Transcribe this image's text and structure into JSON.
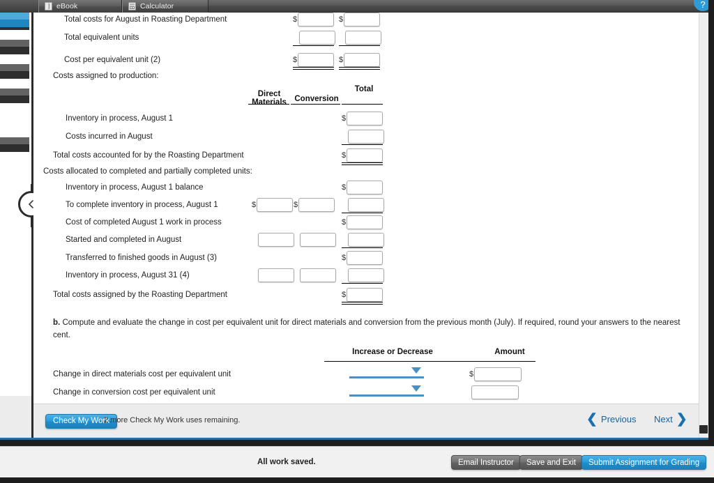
{
  "window": {
    "tabs": [
      {
        "label": "eBook",
        "icon": "book-icon"
      },
      {
        "label": "Calculator",
        "icon": "calculator-icon"
      }
    ]
  },
  "worksheet": {
    "top_rows": [
      {
        "label": "Total costs for August in Roasting Department",
        "dollar": true,
        "underline": "none"
      },
      {
        "label": "Total equivalent units",
        "dollar": false,
        "underline": "single"
      },
      {
        "label": "Cost per equivalent unit (2)",
        "dollar": true,
        "underline": "double"
      }
    ],
    "section_label": "Costs assigned to production:",
    "column_headers": {
      "direct_materials_line1": "Direct",
      "direct_materials_line2": "Materials",
      "conversion": "Conversion",
      "total": "Total"
    },
    "accounted_rows": [
      {
        "label": "Inventory in process, August 1",
        "dollar": true,
        "underline": "none"
      },
      {
        "label": "Costs incurred in August",
        "dollar": false,
        "underline": "single"
      },
      {
        "label": "Total costs accounted for by the Roasting Department",
        "dollar": true,
        "underline": "double"
      }
    ],
    "allocated_label": "Costs allocated to completed and partially completed units:",
    "allocated_rows": [
      {
        "label": "Inventory in process, August 1 balance",
        "dm": false,
        "cv": false,
        "dollar": true,
        "underline": "none"
      },
      {
        "label": "To complete inventory in process, August 1",
        "dm": true,
        "cv": true,
        "dollar": false,
        "underline": "single"
      },
      {
        "label": "Cost of completed August 1 work in process",
        "dm": false,
        "cv": false,
        "dollar": true,
        "underline": "none"
      },
      {
        "label": "Started and completed in August",
        "dm": true,
        "cv": true,
        "dollar": false,
        "underline": "single"
      },
      {
        "label": "Transferred to finished goods in August (3)",
        "dm": false,
        "cv": false,
        "dollar": true,
        "underline": "none"
      },
      {
        "label": "Inventory in process, August 31 (4)",
        "dm": true,
        "cv": true,
        "dollar": false,
        "underline": "single"
      },
      {
        "label": "Total costs assigned by the Roasting Department",
        "dm": false,
        "cv": false,
        "dollar": true,
        "underline": "double"
      }
    ]
  },
  "part_b": {
    "marker": "b.",
    "prompt": "Compute and evaluate the change in cost per equivalent unit for direct materials and conversion from the previous month (July). If required, round your answers to the nearest cent.",
    "headers": {
      "increase_or_decrease": "Increase or Decrease",
      "amount": "Amount"
    },
    "rows": [
      {
        "label": "Change in direct materials cost per equivalent unit",
        "select_value": "",
        "dollar": true,
        "amount": ""
      },
      {
        "label": "Change in conversion cost per equivalent unit",
        "select_value": "",
        "dollar": false,
        "amount": ""
      }
    ]
  },
  "check_my_work": {
    "button_label": "Check My Work",
    "note": "2 more Check My Work uses remaining."
  },
  "pager": {
    "previous_label": "Previous",
    "next_label": "Next",
    "previous_icon": "chevron-left-icon",
    "next_icon": "chevron-right-icon"
  },
  "footer": {
    "status": "All work saved.",
    "email_instructor": "Email Instructor",
    "save_and_exit": "Save and Exit",
    "submit": "Submit Assignment for Grading"
  },
  "colors": {
    "accent_blue": "#2a9ad6",
    "link_blue": "#19639e",
    "select_underline": "#4a90c4",
    "nav_selected": "#4fa9dd"
  },
  "sidebar": {
    "items": [
      {
        "selected": false
      },
      {
        "selected": false
      },
      {
        "selected": false
      },
      {
        "selected": false
      },
      {
        "selected": true
      },
      {
        "selected": false
      }
    ],
    "collapse_icon": "chevron-left-icon"
  }
}
